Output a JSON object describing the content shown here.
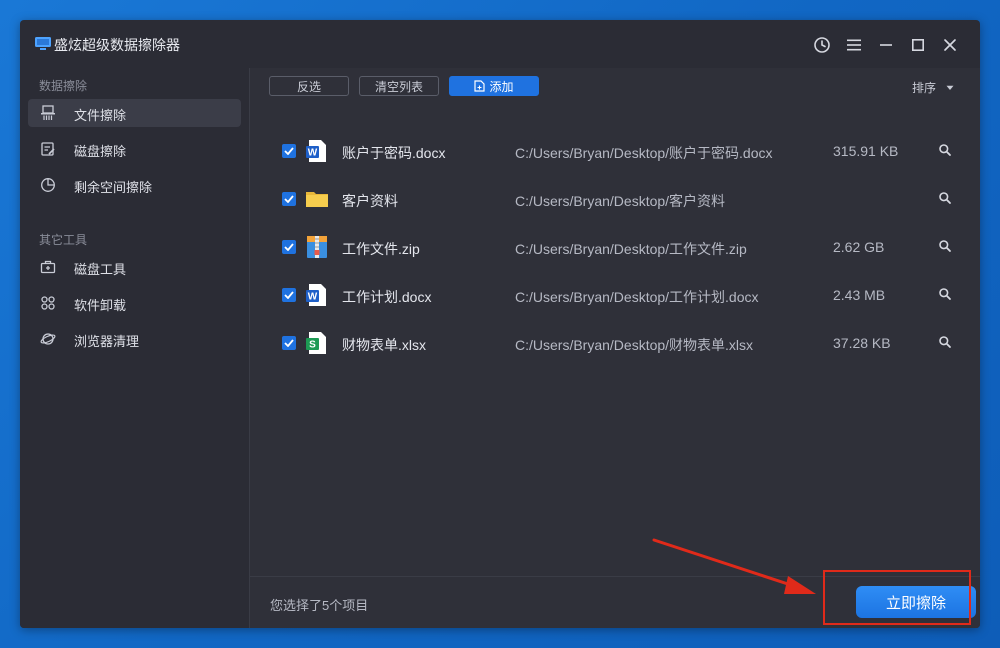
{
  "window": {
    "title": "盛炫超级数据擦除器"
  },
  "titlebar_icons": [
    "history-icon",
    "menu-icon",
    "minimize-icon",
    "maximize-icon",
    "close-icon"
  ],
  "sidebar": {
    "section1_title": "数据擦除",
    "section1_items": [
      {
        "label": "文件擦除",
        "icon": "file-shred-icon",
        "active": true
      },
      {
        "label": "磁盘擦除",
        "icon": "disk-edit-icon",
        "active": false
      },
      {
        "label": "剩余空间擦除",
        "icon": "pie-icon",
        "active": false
      }
    ],
    "section2_title": "其它工具",
    "section2_items": [
      {
        "label": "磁盘工具",
        "icon": "toolbox-icon"
      },
      {
        "label": "软件卸载",
        "icon": "apps-grid-icon"
      },
      {
        "label": "浏览器清理",
        "icon": "planet-icon"
      }
    ]
  },
  "toolbar": {
    "invert_label": "反选",
    "clear_label": "清空列表",
    "add_label": "添加",
    "sort_label": "排序"
  },
  "files": [
    {
      "name": "账户于密码.docx",
      "path": "C:/Users/Bryan/Desktop/账户于密码.docx",
      "size": "315.91 KB",
      "type": "word",
      "checked": true
    },
    {
      "name": "客户资料",
      "path": "C:/Users/Bryan/Desktop/客户资料",
      "size": "",
      "type": "folder",
      "checked": true
    },
    {
      "name": "工作文件.zip",
      "path": "C:/Users/Bryan/Desktop/工作文件.zip",
      "size": "2.62 GB",
      "type": "zip",
      "checked": true
    },
    {
      "name": "工作计划.docx",
      "path": "C:/Users/Bryan/Desktop/工作计划.docx",
      "size": "2.43 MB",
      "type": "word",
      "checked": true
    },
    {
      "name": "财物表单.xlsx",
      "path": "C:/Users/Bryan/Desktop/财物表单.xlsx",
      "size": "37.28 KB",
      "type": "excel",
      "checked": true
    }
  ],
  "footer": {
    "selection_text": "您选择了5个项目",
    "erase_label": "立即擦除"
  },
  "colors": {
    "accent": "#1f72e0",
    "annotation": "#e02a1a"
  }
}
